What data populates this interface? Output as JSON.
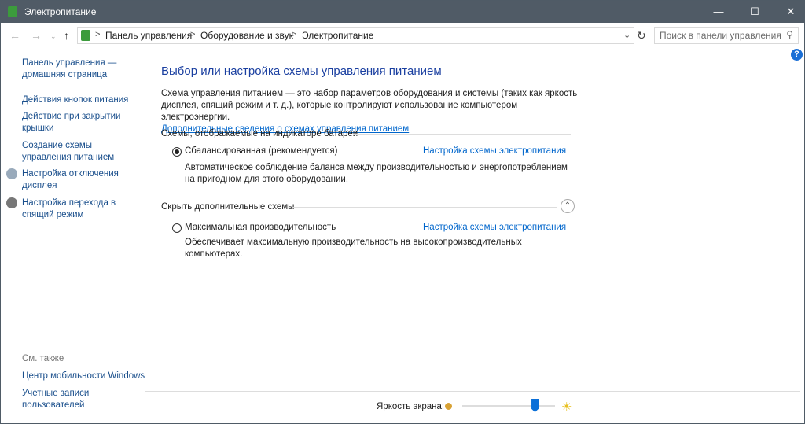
{
  "window": {
    "title": "Электропитание"
  },
  "address": {
    "crumbs": [
      "Панель управления",
      "Оборудование и звук",
      "Электропитание"
    ],
    "search_placeholder": "Поиск в панели управления"
  },
  "sidebar": {
    "home": "Панель управления — домашняя страница",
    "items": [
      "Действия кнопок питания",
      "Действие при закрытии крышки",
      "Создание схемы управления питанием",
      "Настройка отключения дисплея",
      "Настройка перехода в спящий режим"
    ],
    "see_also": "См. также",
    "also_items": [
      "Центр мобильности Windows",
      "Учетные записи пользователей"
    ]
  },
  "main": {
    "title": "Выбор или настройка схемы управления питанием",
    "desc": "Схема управления питанием — это набор параметров оборудования и системы (таких как яркость дисплея, спящий режим и т. д.), которые контролируют использование компьютером электроэнергии.",
    "more_link": "Дополнительные сведения о схемах управления питанием",
    "group1": "Схемы, отображаемые на индикаторе батареи",
    "group2": "Скрыть дополнительные схемы",
    "plans": [
      {
        "name": "Сбалансированная (рекомендуется)",
        "selected": true,
        "link": "Настройка схемы электропитания",
        "desc": "Автоматическое соблюдение баланса между производительностью и энергопотреблением на пригодном для этого оборудовании."
      },
      {
        "name": "Максимальная производительность",
        "selected": false,
        "link": "Настройка схемы электропитания",
        "desc": "Обеспечивает максимальную производительность на высокопроизводительных компьютерах."
      }
    ]
  },
  "brightness": {
    "label": "Яркость экрана:",
    "value_percent": 78
  }
}
